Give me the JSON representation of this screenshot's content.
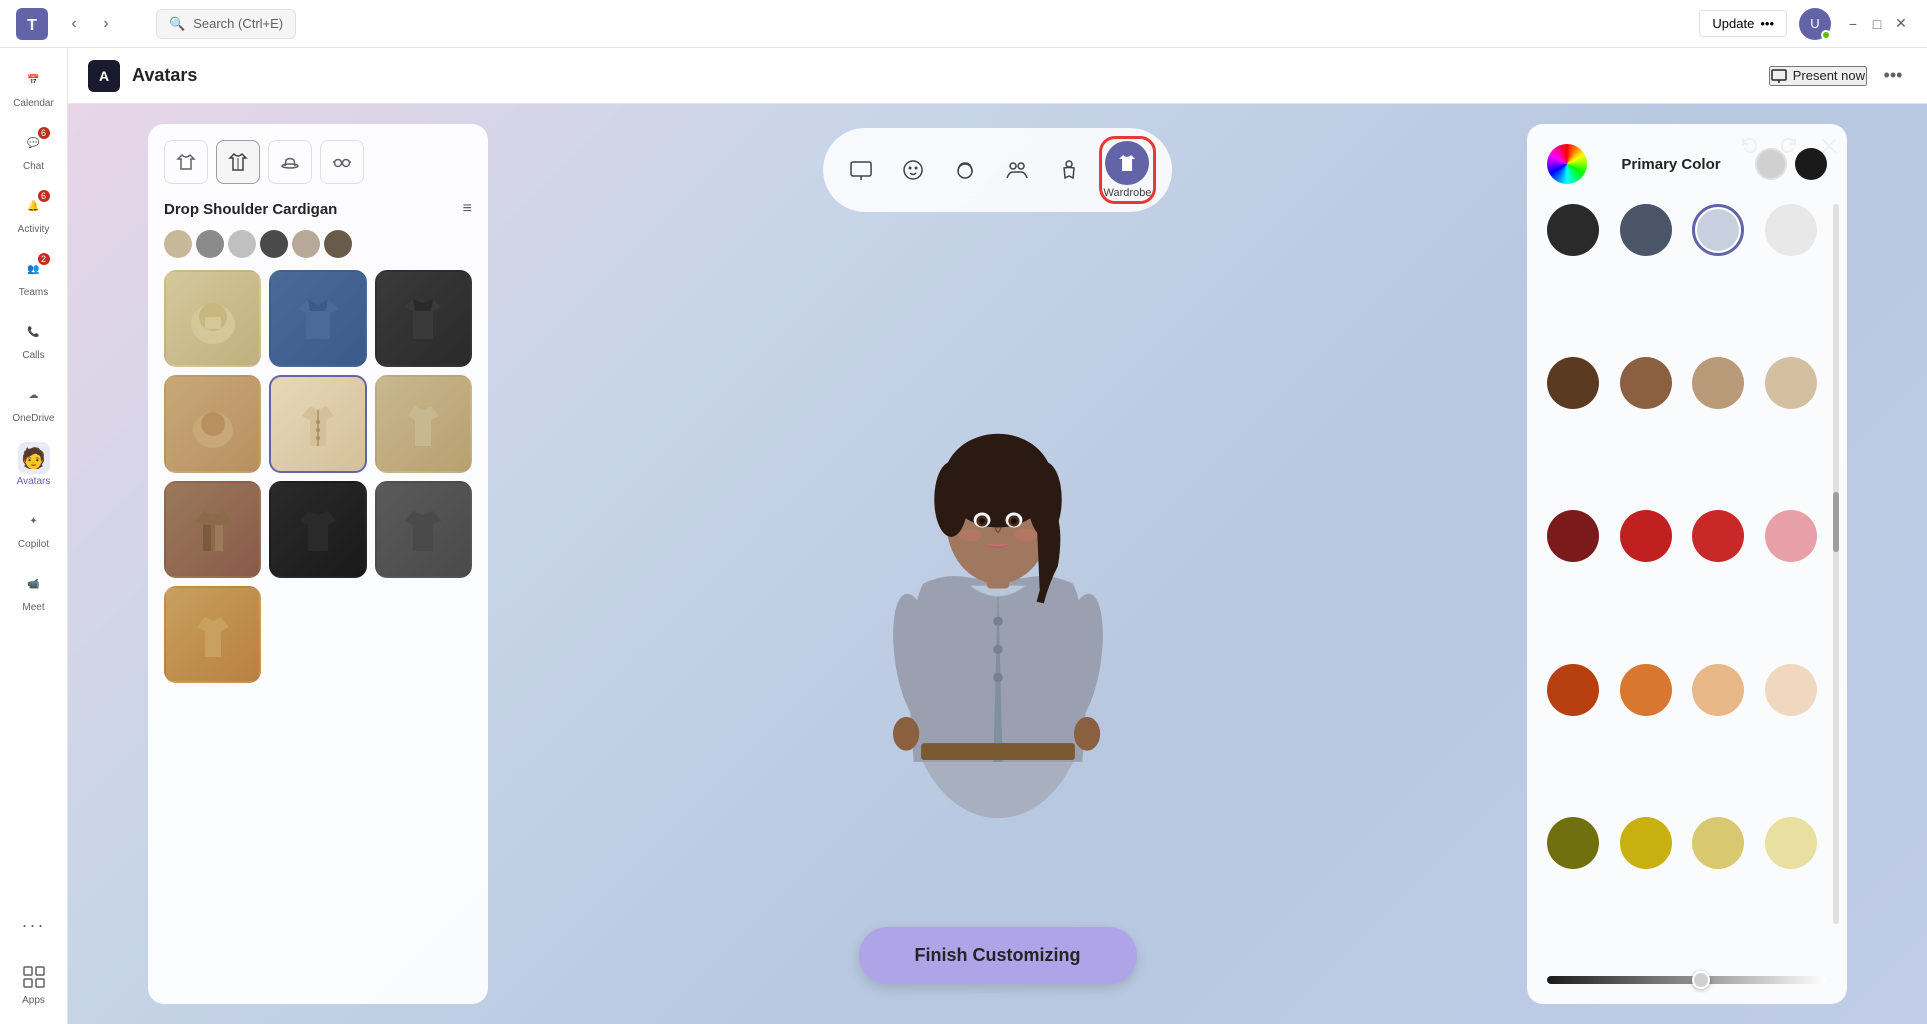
{
  "titlebar": {
    "search_placeholder": "Search (Ctrl+E)",
    "update_label": "Update",
    "update_dots": "•••",
    "minimize": "−",
    "maximize": "□",
    "close": "✕"
  },
  "sidebar": {
    "items": [
      {
        "id": "calendar",
        "label": "Calendar",
        "icon": "📅",
        "badge": null
      },
      {
        "id": "chat",
        "label": "Chat",
        "icon": "💬",
        "badge": "6"
      },
      {
        "id": "activity",
        "label": "Activity",
        "icon": "🔔",
        "badge": "6"
      },
      {
        "id": "teams",
        "label": "Teams",
        "icon": "👥",
        "badge": "2"
      },
      {
        "id": "calls",
        "label": "Calls",
        "icon": "📞",
        "badge": null
      },
      {
        "id": "onedrive",
        "label": "OneDrive",
        "icon": "☁",
        "badge": null
      },
      {
        "id": "avatars",
        "label": "Avatars",
        "icon": "🧑",
        "badge": null,
        "active": true
      },
      {
        "id": "copilot",
        "label": "Copilot",
        "icon": "✦",
        "badge": null
      },
      {
        "id": "meet",
        "label": "Meet",
        "icon": "📹",
        "badge": null
      },
      {
        "id": "more",
        "label": "•••",
        "icon": "•••",
        "badge": null
      },
      {
        "id": "apps",
        "label": "Apps",
        "icon": "⊞",
        "badge": null
      }
    ]
  },
  "app_header": {
    "title": "Avatars",
    "present_now": "Present now",
    "more_options": "•••"
  },
  "toolbar": {
    "buttons": [
      {
        "id": "screen",
        "icon": "🖥",
        "label": ""
      },
      {
        "id": "face",
        "icon": "😊",
        "label": ""
      },
      {
        "id": "hair",
        "icon": "👤",
        "label": ""
      },
      {
        "id": "group",
        "icon": "👥",
        "label": ""
      },
      {
        "id": "body",
        "icon": "🦾",
        "label": ""
      },
      {
        "id": "wardrobe",
        "icon": "👕",
        "label": "Wardrobe",
        "active": true
      }
    ],
    "undo": "↩",
    "redo": "↪",
    "close": "✕"
  },
  "left_panel": {
    "tabs": [
      {
        "id": "top",
        "icon": "👕"
      },
      {
        "id": "pants",
        "icon": "👔",
        "active": true
      },
      {
        "id": "hat",
        "icon": "🎩"
      },
      {
        "id": "glasses",
        "icon": "👓"
      }
    ],
    "category": "Drop Shoulder Cardigan",
    "color_strip": [
      "#c8b89a",
      "#8a8a8a",
      "#c0c0c0",
      "#4a4a4a",
      "#b8a898",
      "#6a5a4a"
    ],
    "items": [
      {
        "id": 1,
        "emoji": "🧥",
        "color": "#d4c89a",
        "selected": false,
        "row": 1
      },
      {
        "id": 2,
        "emoji": "🧥",
        "color": "#4a6a9a",
        "selected": false,
        "row": 1
      },
      {
        "id": 3,
        "emoji": "🧥",
        "color": "#2a2a2a",
        "selected": false,
        "row": 1
      },
      {
        "id": 4,
        "emoji": "🧥",
        "color": "#c8a878",
        "selected": false,
        "row": 2
      },
      {
        "id": 5,
        "emoji": "🧥",
        "color": "#d4b88a",
        "selected": true,
        "row": 2
      },
      {
        "id": 6,
        "emoji": "🧥",
        "color": "#c8b890",
        "selected": false,
        "row": 2
      },
      {
        "id": 7,
        "emoji": "🧥",
        "color": "#8a5a4a",
        "selected": false,
        "row": 3
      },
      {
        "id": 8,
        "emoji": "🧥",
        "color": "#1a1a1a",
        "selected": false,
        "row": 3
      },
      {
        "id": 9,
        "emoji": "🧥",
        "color": "#4a4a4a",
        "selected": false,
        "row": 3
      },
      {
        "id": 10,
        "emoji": "🧥",
        "color": "#c8a060",
        "selected": false,
        "row": 4
      }
    ]
  },
  "right_panel": {
    "primary_color_label": "Primary Color",
    "colors": [
      {
        "hex": "#2a2a2a",
        "selected": false
      },
      {
        "hex": "#4a5568",
        "selected": false
      },
      {
        "hex": "#c8d0e0",
        "selected": true
      },
      {
        "hex": "#e8e8e8",
        "selected": false
      },
      {
        "hex": "#5a3a20",
        "selected": false
      },
      {
        "hex": "#8a6040",
        "selected": false
      },
      {
        "hex": "#b89a78",
        "selected": false
      },
      {
        "hex": "#d4c0a0",
        "selected": false
      },
      {
        "hex": "#7a1a1a",
        "selected": false
      },
      {
        "hex": "#c02020",
        "selected": false
      },
      {
        "hex": "#c82828",
        "selected": false
      },
      {
        "hex": "#e8a0a8",
        "selected": false
      },
      {
        "hex": "#b84010",
        "selected": false
      },
      {
        "hex": "#d87830",
        "selected": false
      },
      {
        "hex": "#e8b888",
        "selected": false
      },
      {
        "hex": "#f0d8c0",
        "selected": false
      },
      {
        "hex": "#707010",
        "selected": false
      },
      {
        "hex": "#c8b010",
        "selected": false
      },
      {
        "hex": "#d8c870",
        "selected": false
      },
      {
        "hex": "#e8e0a0",
        "selected": false
      }
    ]
  },
  "finish_btn": "Finish Customizing"
}
